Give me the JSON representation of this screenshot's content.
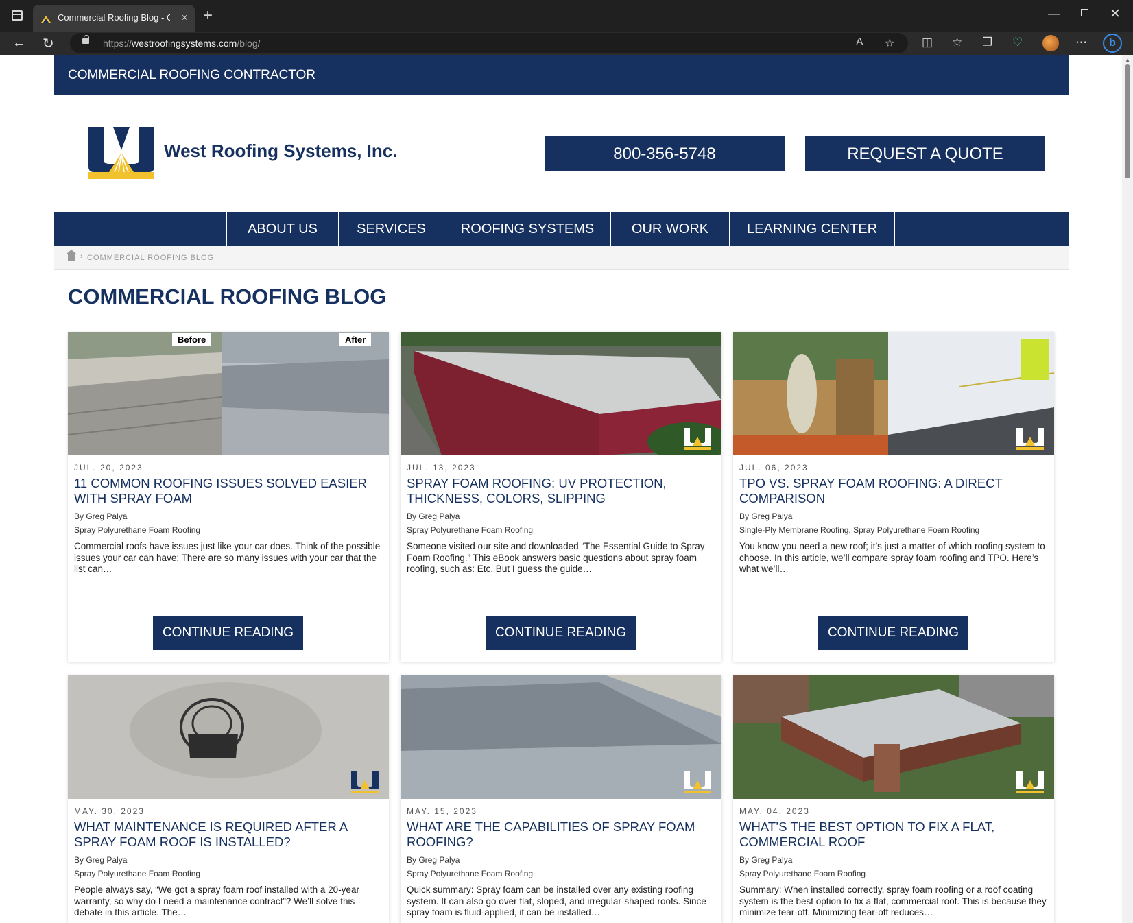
{
  "browser": {
    "tab_title": "Commercial Roofing Blog - Cleve",
    "url_scheme": "https://",
    "url_domain": "westroofingsystems.com",
    "url_path": "/blog/"
  },
  "site": {
    "top_strip": "COMMERCIAL ROOFING CONTRACTOR",
    "brand": "West Roofing Systems, Inc.",
    "phone": "800-356-5748",
    "quote_button": "REQUEST A QUOTE",
    "nav": [
      "ABOUT US",
      "SERVICES",
      "ROOFING SYSTEMS",
      "OUR WORK",
      "LEARNING CENTER"
    ],
    "breadcrumb": "COMMERCIAL ROOFING BLOG",
    "page_title": "COMMERCIAL ROOFING BLOG"
  },
  "posts": [
    {
      "date": "JUL. 20, 2023",
      "title": "11 COMMON ROOFING ISSUES SOLVED EASIER WITH SPRAY FOAM",
      "author": "By Greg Palya",
      "category": "Spray Polyurethane Foam Roofing",
      "excerpt": "Commercial roofs have issues just like your car does. Think of the possible issues your car can have: There are so many issues with your car that the list can…",
      "button": "CONTINUE READING",
      "image_labels": [
        "Before",
        "After"
      ]
    },
    {
      "date": "JUL. 13, 2023",
      "title": "SPRAY FOAM ROOFING: UV PROTECTION, THICKNESS, COLORS, SLIPPING",
      "author": "By Greg Palya",
      "category": "Spray Polyurethane Foam Roofing",
      "excerpt": "Someone visited our site and downloaded “The Essential Guide to Spray Foam Roofing.” This eBook answers basic questions about spray foam roofing, such as: Etc. But I guess the guide…",
      "button": "CONTINUE READING"
    },
    {
      "date": "JUL. 06, 2023",
      "title": "TPO VS. SPRAY FOAM ROOFING: A DIRECT COMPARISON",
      "author": "By Greg Palya",
      "category": "Single-Ply Membrane Roofing, Spray Polyurethane Foam Roofing",
      "excerpt": "You know you need a new roof; it’s just a matter of which roofing system to choose. In this article, we’ll compare spray foam roofing and TPO. Here’s what we’ll…",
      "button": "CONTINUE READING"
    },
    {
      "date": "MAY. 30, 2023",
      "title": "WHAT MAINTENANCE IS REQUIRED AFTER A SPRAY FOAM ROOF IS INSTALLED?",
      "author": "By Greg Palya",
      "category": "Spray Polyurethane Foam Roofing",
      "excerpt": "People always say, “We got a spray foam roof installed with a 20-year warranty, so why do I need a maintenance contract”? We’ll solve this debate in this article. The…"
    },
    {
      "date": "MAY. 15, 2023",
      "title": "WHAT ARE THE CAPABILITIES OF SPRAY FOAM ROOFING?",
      "author": "By Greg Palya",
      "category": "Spray Polyurethane Foam Roofing",
      "excerpt": "Quick summary: Spray foam can be installed over any existing roofing system. It can also go over flat, sloped, and irregular-shaped roofs. Since spray foam is fluid-applied, it can be installed…"
    },
    {
      "date": "MAY. 04, 2023",
      "title": "WHAT’S THE BEST OPTION TO FIX A FLAT, COMMERCIAL ROOF",
      "author": "By Greg Palya",
      "category": "Spray Polyurethane Foam Roofing",
      "excerpt": "Summary: When installed correctly, spray foam roofing or a roof coating system is the best option to fix a flat, commercial roof. This is because they minimize tear-off. Minimizing tear-off reduces…"
    }
  ],
  "colors": {
    "brand_navy": "#16305f",
    "brand_gold": "#f2c12e",
    "browser_chrome": "#202020"
  }
}
